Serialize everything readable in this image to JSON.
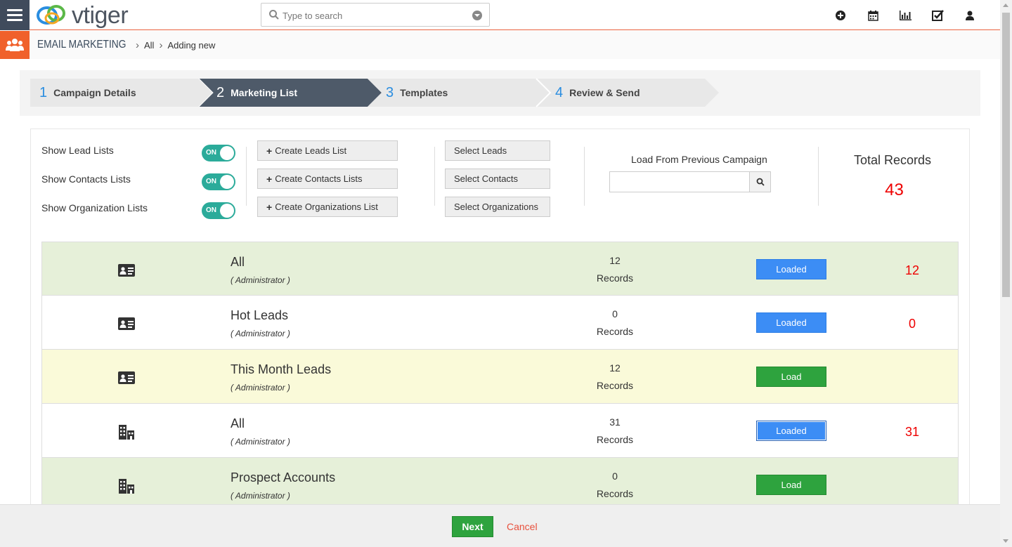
{
  "header": {
    "logo_text": "vtiger",
    "search_placeholder": "Type to search",
    "icons": [
      "plus-circle-icon",
      "calendar-icon",
      "chart-icon",
      "checkbox-icon",
      "user-icon"
    ]
  },
  "breadcrumb": {
    "module": "EMAIL MARKETING",
    "filter": "All",
    "page": "Adding new"
  },
  "steps": [
    {
      "num": "1",
      "label": "Campaign Details"
    },
    {
      "num": "2",
      "label": "Marketing List"
    },
    {
      "num": "3",
      "label": "Templates"
    },
    {
      "num": "4",
      "label": "Review & Send"
    }
  ],
  "toggles": [
    {
      "label": "Show Lead Lists",
      "state": "ON"
    },
    {
      "label": "Show Contacts Lists",
      "state": "ON"
    },
    {
      "label": "Show Organization Lists",
      "state": "ON"
    }
  ],
  "create_buttons": [
    {
      "label": "Create Leads List"
    },
    {
      "label": "Create Contacts Lists"
    },
    {
      "label": "Create Organizations List"
    }
  ],
  "select_buttons": [
    {
      "label": "Select Leads"
    },
    {
      "label": "Select Contacts"
    },
    {
      "label": "Select Organizations"
    }
  ],
  "load_previous": {
    "label": "Load From Previous Campaign",
    "value": ""
  },
  "total": {
    "label": "Total Records",
    "value": "43"
  },
  "lists": [
    {
      "type": "lead",
      "name": "All",
      "owner": "( Administrator )",
      "count": "12",
      "records": "Records",
      "button": "Loaded",
      "loaded_value": "12",
      "bg": "green"
    },
    {
      "type": "lead",
      "name": "Hot Leads",
      "owner": "( Administrator )",
      "count": "0",
      "records": "Records",
      "button": "Loaded",
      "loaded_value": "0",
      "bg": "white"
    },
    {
      "type": "lead",
      "name": "This Month Leads",
      "owner": "( Administrator )",
      "count": "12",
      "records": "Records",
      "button": "Load",
      "loaded_value": "",
      "bg": "yellow"
    },
    {
      "type": "org",
      "name": "All",
      "owner": "( Administrator )",
      "count": "31",
      "records": "Records",
      "button": "Loaded",
      "loaded_value": "31",
      "bg": "white"
    },
    {
      "type": "org",
      "name": "Prospect Accounts",
      "owner": "( Administrator )",
      "count": "0",
      "records": "Records",
      "button": "Load",
      "loaded_value": "",
      "bg": "green"
    }
  ],
  "footer": {
    "next": "Next",
    "cancel": "Cancel"
  },
  "colors": {
    "accent": "#f0612b",
    "nav": "#404b5c",
    "loaded": "#3c8df5",
    "load": "#2ea33e",
    "total": "#e00000"
  }
}
